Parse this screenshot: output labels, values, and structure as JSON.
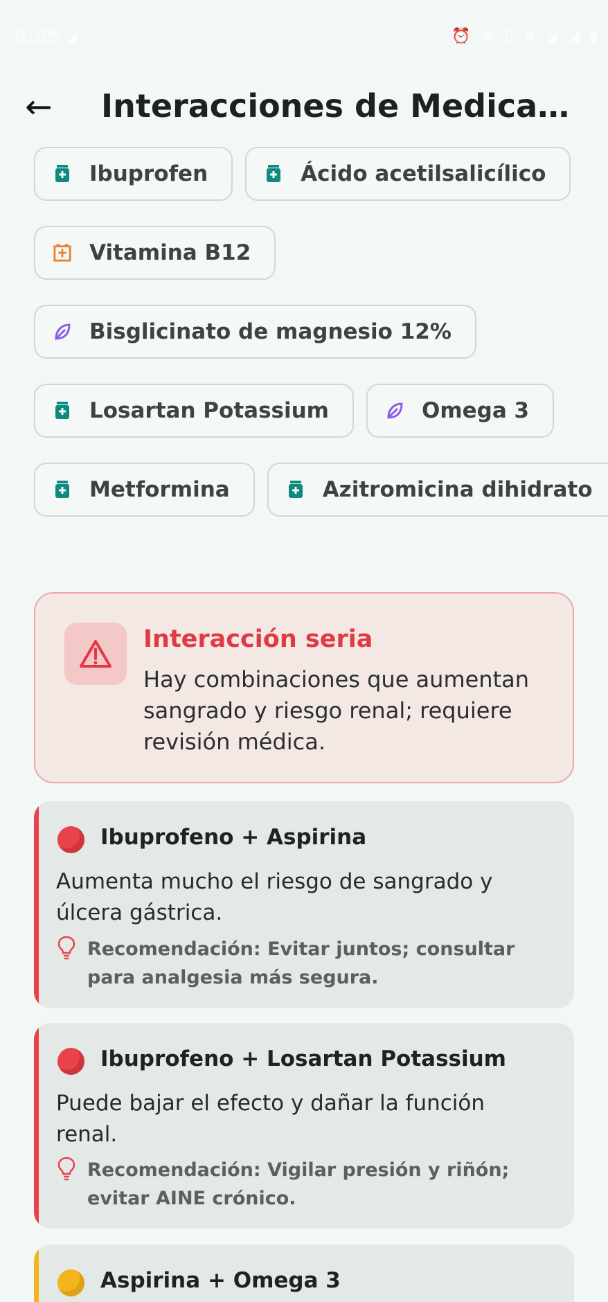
{
  "status_bar": {
    "time": "8:55",
    "left_icon": "signal-icon",
    "icons": [
      "alarm-icon",
      "eye-icon",
      "vibrate-icon",
      "wifi-icon",
      "signal-icon",
      "cellular-icon",
      "battery-icon"
    ]
  },
  "header": {
    "title": "Interacciones de Medicame…",
    "back_icon": "arrow-left-icon"
  },
  "chips": [
    [
      {
        "label": "Ibuprofen",
        "type": "medication",
        "icon": "medicine-bottle-icon",
        "color": "#0e8b80"
      },
      {
        "label": "Ácido acetilsalicílico",
        "type": "medication",
        "icon": "medicine-bottle-icon",
        "color": "#0e8b80"
      }
    ],
    [
      {
        "label": "Vitamina B12",
        "type": "vitamin",
        "icon": "vitamin-icon",
        "color": "#ef7d2d"
      }
    ],
    [
      {
        "label": "Bisglicinato de magnesio 12%",
        "type": "supplement",
        "icon": "leaf-icon",
        "color": "#8e5be8"
      }
    ],
    [
      {
        "label": "Losartan Potassium",
        "type": "medication",
        "icon": "medicine-bottle-icon",
        "color": "#0e8b80"
      },
      {
        "label": "Omega 3",
        "type": "supplement",
        "icon": "leaf-icon",
        "color": "#8e5be8"
      }
    ],
    [
      {
        "label": "Metformina",
        "type": "medication",
        "icon": "medicine-bottle-icon",
        "color": "#0e8b80"
      },
      {
        "label": "Azitromicina dihidrato",
        "type": "medication",
        "icon": "medicine-bottle-icon",
        "color": "#0e8b80"
      }
    ]
  ],
  "warning": {
    "title": "Interacción seria",
    "text": "Hay combinaciones que aumentan sangrado y riesgo renal; requiere revisión médica.",
    "icon": "warning-triangle-icon"
  },
  "interactions": [
    {
      "severity": "high",
      "title": "Ibuprofeno + Aspirina",
      "description": "Aumenta mucho el riesgo de sangrado y úlcera gástrica.",
      "recommendation": "Recomendación: Evitar juntos; consultar para analgesia más segura.",
      "color": "#e8434b"
    },
    {
      "severity": "high",
      "title": "Ibuprofeno + Losartan Potassium",
      "description": "Puede bajar el efecto y dañar la función renal.",
      "recommendation": "Recomendación: Vigilar presión y riñón; evitar AINE crónico.",
      "color": "#e8434b"
    },
    {
      "severity": "moderate",
      "title": "Aspirina + Omega 3",
      "description": "",
      "recommendation": "",
      "color": "#f2b51d"
    }
  ]
}
